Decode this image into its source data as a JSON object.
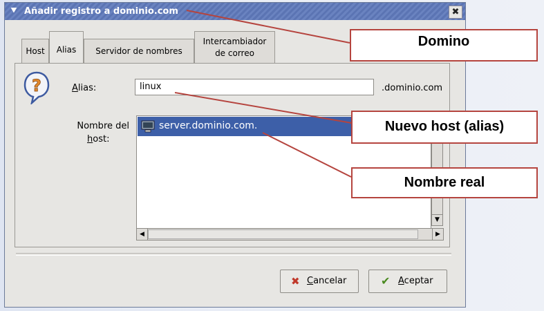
{
  "window": {
    "title": "Añadir registro a  dominio.com",
    "menu_icon": "chevron-down-icon",
    "close_icon": "close-icon",
    "close_glyph": "✖"
  },
  "tabs": [
    {
      "label": "Host"
    },
    {
      "label": "Alias"
    },
    {
      "label": "Servidor de nombres"
    },
    {
      "label_line1": "Intercambiador",
      "label_line2": "de correo"
    }
  ],
  "form": {
    "alias_label_first": "A",
    "alias_label_rest": "lias:",
    "alias_value": "linux",
    "alias_suffix": ".dominio.com",
    "host_label_line1": "Nombre del",
    "host_label_line2_first": "h",
    "host_label_line2_rest": "ost:",
    "host_list": [
      "server.dominio.com."
    ]
  },
  "buttons": {
    "cancel_first": "C",
    "cancel_rest": "ancelar",
    "accept_first": "A",
    "accept_rest": "ceptar"
  },
  "annotations": {
    "domain": "Domino",
    "new_host": "Nuevo host (alias)",
    "real_name": "Nombre real"
  },
  "colors": {
    "selection": "#3d5fa8",
    "annotation_border": "#b5443e",
    "titlebar": "#5b74b3"
  }
}
